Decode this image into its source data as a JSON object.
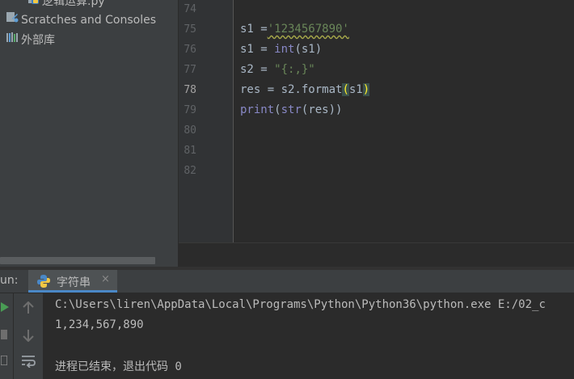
{
  "project_tree": {
    "items": [
      {
        "label": "逻辑运算.py",
        "icon": "python-file-icon"
      },
      {
        "label": "Scratches and Consoles",
        "icon": "scratches-icon"
      },
      {
        "label": "外部库",
        "icon": "external-libraries-icon"
      }
    ]
  },
  "editor": {
    "line_numbers": [
      "74",
      "75",
      "76",
      "77",
      "78",
      "79",
      "80",
      "81",
      "82"
    ],
    "active_line": "78",
    "code": {
      "l75": {
        "a": "s1 =",
        "b": "'1234567890'"
      },
      "l76": {
        "a": "s1 = ",
        "b": "int",
        "c": "(s1)"
      },
      "l77": {
        "a": "s2 = ",
        "b": "\"{:,}\""
      },
      "l78": {
        "a": "res = s2.format",
        "b": "(",
        "c": "s1",
        "d": ")"
      },
      "l79": {
        "a": "print",
        "b": "(",
        "c": "str",
        "d": "(res))"
      }
    }
  },
  "run_panel": {
    "label": "un:",
    "tab_label": "字符串",
    "tab_close": "×",
    "console_lines": [
      "C:\\Users\\liren\\AppData\\Local\\Programs\\Python\\Python36\\python.exe E:/02_c",
      "1,234,567,890",
      "",
      "进程已结束，退出代码 0"
    ]
  },
  "colors": {
    "accent": "#4a88c7",
    "run_green": "#499c54",
    "string_green": "#6a8759",
    "builtin_purple": "#8888c6"
  }
}
